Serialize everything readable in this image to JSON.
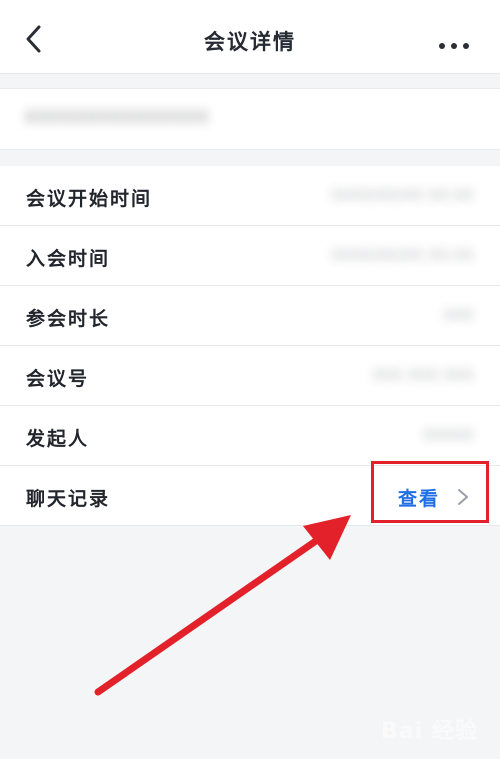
{
  "header": {
    "title": "会议详情",
    "back_icon": "chevron-left-icon",
    "more_icon": "more-dots-icon"
  },
  "meeting": {
    "name": "XXXXXXXXXXXXXXX"
  },
  "details": [
    {
      "label": "会议开始时间",
      "value": "XXXX/XX/XX XX:XX"
    },
    {
      "label": "入会时间",
      "value": "XXXX/XX/XX XX:XX"
    },
    {
      "label": "参会时长",
      "value": "XXX"
    },
    {
      "label": "会议号",
      "value": "XXX XXX XXX"
    },
    {
      "label": "发起人",
      "value": "XXXXX"
    }
  ],
  "chat": {
    "label": "聊天记录",
    "action": "查看",
    "action_color": "#1f6fe5"
  },
  "annotation": {
    "highlight_color": "#e2212b"
  },
  "watermark": "Bai 经验"
}
